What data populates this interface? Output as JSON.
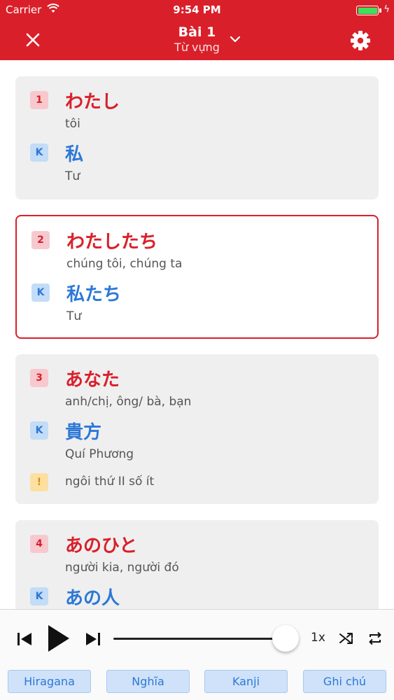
{
  "status_bar": {
    "carrier": "Carrier",
    "time": "9:54 PM",
    "battery_color": "#3fe05a"
  },
  "nav": {
    "title": "Bài 1",
    "subtitle": "Từ vựng",
    "close_icon": "close-icon",
    "chevron_icon": "chevron-down-icon",
    "settings_icon": "gear-icon",
    "bar_color": "#d9202a"
  },
  "cards": [
    {
      "number": "1",
      "kana": "わたし",
      "meaning": "tôi",
      "kanji_badge": "K",
      "kanji": "私",
      "kanji_reading": "Tư",
      "selected": false
    },
    {
      "number": "2",
      "kana": "わたしたち",
      "meaning": "chúng tôi, chúng ta",
      "kanji_badge": "K",
      "kanji": "私たち",
      "kanji_reading": "Tư",
      "selected": true
    },
    {
      "number": "3",
      "kana": "あなた",
      "meaning": "anh/chị, ông/ bà, bạn",
      "kanji_badge": "K",
      "kanji": "貴方",
      "kanji_reading": "Quí Phương",
      "note_badge": "!",
      "note": "ngôi thứ II số ít",
      "selected": false
    },
    {
      "number": "4",
      "kana": "あのひと",
      "meaning": "người kia, người đó",
      "kanji_badge": "K",
      "kanji": "あの人",
      "selected": false
    }
  ],
  "player": {
    "speed": "1x",
    "progress": 0.95,
    "prev_icon": "skip-previous-icon",
    "play_icon": "play-icon",
    "next_icon": "skip-next-icon",
    "shuffle_icon": "shuffle-icon",
    "repeat_icon": "repeat-icon"
  },
  "filters": [
    "Hiragana",
    "Nghĩa",
    "Kanji",
    "Ghi chú"
  ]
}
